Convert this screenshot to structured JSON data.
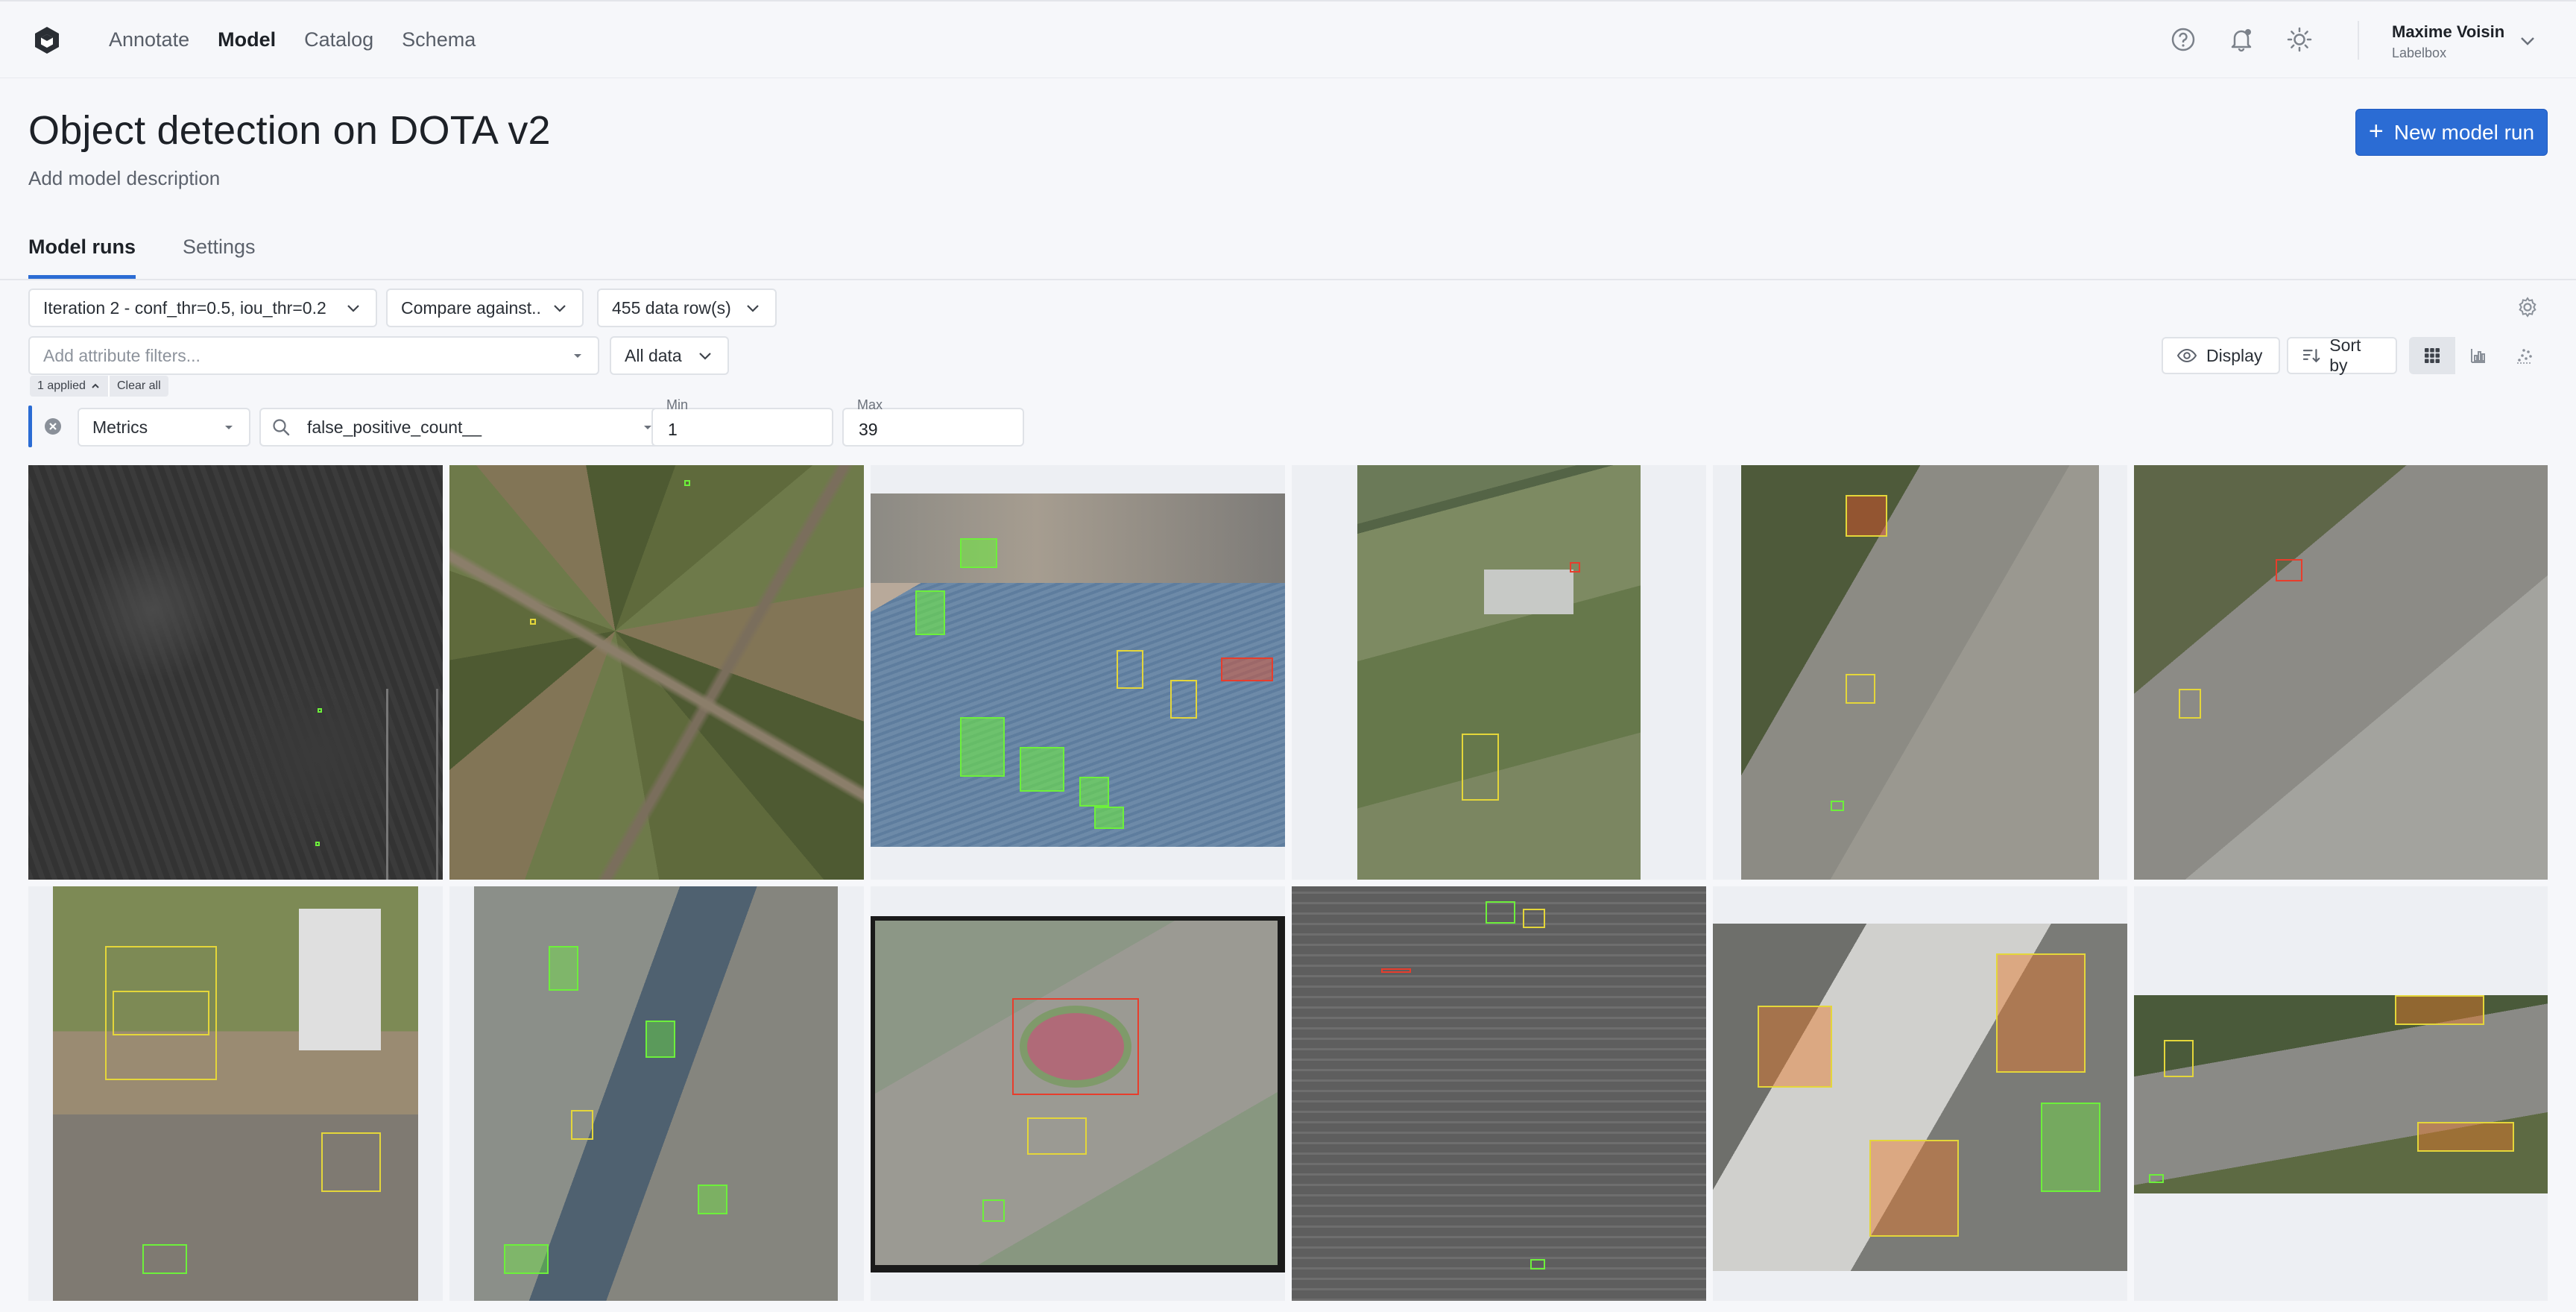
{
  "nav": {
    "links": [
      "Annotate",
      "Model",
      "Catalog",
      "Schema"
    ],
    "active": "Model",
    "icons": [
      "help-circle-icon",
      "bell-icon",
      "sun-icon"
    ],
    "user_name": "Maxime Voisin",
    "user_org": "Labelbox"
  },
  "header": {
    "title": "Object detection on DOTA v2",
    "description": "Add model description",
    "new_run_label": "New model run"
  },
  "tabs": [
    "Model runs",
    "Settings"
  ],
  "toolbar": {
    "run_select": "Iteration 2 - conf_thr=0.5, iou_thr=0.2",
    "compare_select": "Compare against...",
    "rows_select": "455 data row(s)",
    "attribute_filter_placeholder": "Add attribute filters...",
    "data_select": "All data",
    "display_label": "Display",
    "sort_label": "Sort by",
    "view_modes": [
      "grid-view-icon",
      "chart-view-icon",
      "scatter-view-icon"
    ],
    "active_view": "grid-view-icon"
  },
  "filters": {
    "applied_label": "1 applied",
    "clear_label": "Clear all",
    "category": "Metrics",
    "metric": "false_positive_count__",
    "min_label": "Min",
    "min_value": "1",
    "max_label": "Max",
    "max_value": "39"
  },
  "colors": {
    "accent": "#2b6cd4",
    "box_true_positive": "#6df03b",
    "box_overlap": "#e4d63a",
    "box_false_positive": "#e83d2c"
  },
  "thumbnails": [
    {
      "name": "thumbnail-1",
      "tone": "dark-gray"
    },
    {
      "name": "thumbnail-2",
      "tone": "farmland"
    },
    {
      "name": "thumbnail-3",
      "tone": "harbor"
    },
    {
      "name": "thumbnail-4",
      "tone": "rural"
    },
    {
      "name": "thumbnail-5",
      "tone": "suburban"
    },
    {
      "name": "thumbnail-6",
      "tone": "urban"
    },
    {
      "name": "thumbnail-7",
      "tone": "construction"
    },
    {
      "name": "thumbnail-8",
      "tone": "port-city"
    },
    {
      "name": "thumbnail-9",
      "tone": "stadium"
    },
    {
      "name": "thumbnail-10",
      "tone": "gray-city"
    },
    {
      "name": "thumbnail-11",
      "tone": "parking"
    },
    {
      "name": "thumbnail-12",
      "tone": "rail"
    }
  ]
}
